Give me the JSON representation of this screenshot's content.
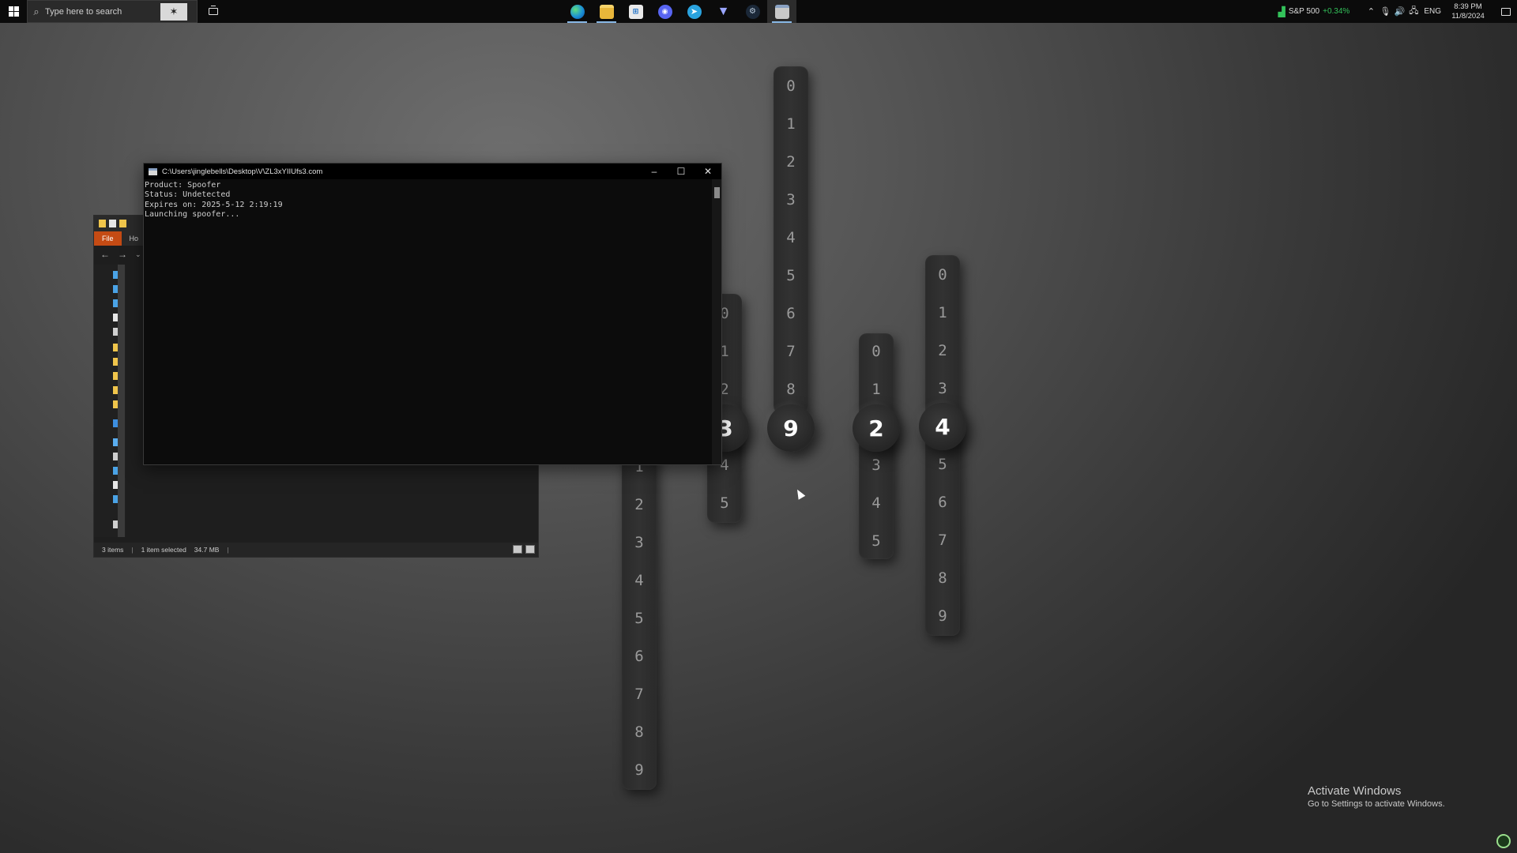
{
  "taskbar": {
    "search_placeholder": "Type here to search",
    "pinned": [
      {
        "icon": "edge-icon",
        "glyph": ""
      },
      {
        "icon": "file-explorer-icon",
        "glyph": ""
      },
      {
        "icon": "microsoft-store-icon",
        "glyph": "⊞"
      },
      {
        "icon": "discord-icon",
        "glyph": "◉"
      },
      {
        "icon": "telegram-icon",
        "glyph": "➤"
      },
      {
        "icon": "vpn-icon",
        "glyph": "▼"
      },
      {
        "icon": "steam-icon",
        "glyph": "⚙"
      },
      {
        "icon": "console-icon",
        "glyph": ""
      }
    ],
    "stock": {
      "name": "S&P 500",
      "change": "+0.34%",
      "change_color": "#33c25a"
    },
    "language": "ENG",
    "time": "8:39 PM",
    "date": "11/8/2024"
  },
  "console": {
    "title": "C:\\Users\\jinglebells\\Desktop\\V\\ZL3xYIIUfs3.com",
    "lines": [
      "Product: Spoofer",
      "Status: Undetected",
      "Expires on: 2025-5-12 2:19:19",
      "Launching spoofer..."
    ]
  },
  "explorer": {
    "ribbon_file": "File",
    "ribbon_tab": "Ho",
    "status_items": "3 items",
    "status_selected": "1 item selected",
    "status_size": "34.7 MB"
  },
  "counters": [
    {
      "digits": [
        "1",
        "2",
        "3",
        "4",
        "5",
        "6",
        "7",
        "8",
        "9"
      ],
      "selected": null
    },
    {
      "digits": [
        "0",
        "1",
        "2",
        "4",
        "5"
      ],
      "selected": "3"
    },
    {
      "digits": [
        "0",
        "1",
        "2",
        "3",
        "4",
        "5",
        "6",
        "7",
        "8"
      ],
      "selected": "9"
    },
    {
      "digits": [
        "0",
        "1",
        "3",
        "4",
        "5"
      ],
      "selected": "2"
    },
    {
      "digits": [
        "0",
        "1",
        "2",
        "3",
        "5",
        "6",
        "7",
        "8",
        "9"
      ],
      "selected": "4"
    }
  ],
  "watermark": {
    "title": "Activate Windows",
    "subtitle": "Go to Settings to activate Windows."
  }
}
